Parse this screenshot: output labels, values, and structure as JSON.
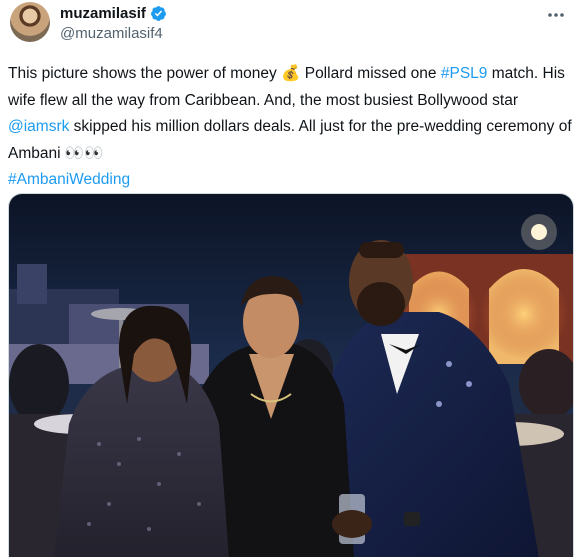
{
  "author": {
    "display_name": "muzamilasif",
    "handle": "@muzamilasif4"
  },
  "tweet": {
    "t1": "This picture shows the power of money ",
    "emoji_money": "💰",
    "t2": " Pollard missed one ",
    "hashtag_psl": "#PSL9",
    "t3": " match. His wife flew all the way from Caribbean. And, the most busiest Bollywood star ",
    "mention_srk": "@iamsrk",
    "t4": " skipped his million dollars deals. All just for the pre-wedding ceremony of Ambani ",
    "emoji_eyes": "👀👀",
    "hashtag_ambani": "#AmbaniWedding"
  },
  "colors": {
    "link": "#1d9bf0",
    "verified": "#1d9bf0",
    "handle": "#536471"
  },
  "icons": {
    "verified": "verified-badge-icon",
    "more": "more-options-icon"
  }
}
